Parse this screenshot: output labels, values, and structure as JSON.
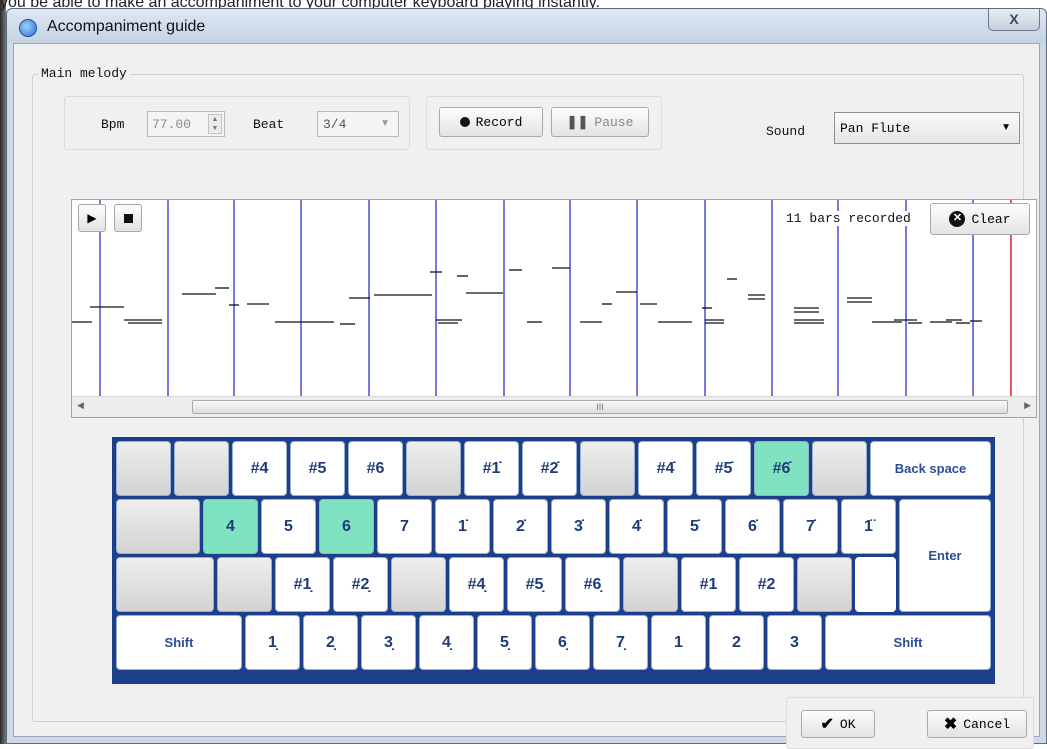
{
  "background_text": "you be able to make an accompaniment to your computer keyboard playing instantly.",
  "window": {
    "title": "Accompaniment guide",
    "close_label": "X"
  },
  "main_melody": {
    "group_label": "Main melody",
    "bpm_label": "Bpm",
    "bpm_value": "77.00",
    "beat_label": "Beat",
    "beat_value": "3/4",
    "record_label": "Record",
    "pause_label": "Pause",
    "sound_label": "Sound",
    "sound_value": "Pan Flute"
  },
  "staff": {
    "bars_recorded": "11 bars recorded",
    "clear_label": "Clear",
    "scroll_mark": "III"
  },
  "keyboard": {
    "row1": [
      "",
      "",
      "#4",
      "#5",
      "#6",
      "",
      "#1̇",
      "#2̇",
      "",
      "#4̇",
      "#5̇",
      "#6̇",
      "",
      "Back space"
    ],
    "row2": [
      "",
      "4",
      "5",
      "6",
      "7",
      "1̇",
      "2̇",
      "3̇",
      "4̇",
      "5̇",
      "6̇",
      "7̇",
      "1̈",
      "Enter"
    ],
    "row3": [
      "",
      "",
      "#1̣",
      "#2̣",
      "",
      "#4̣",
      "#5̣",
      "#6̣",
      "",
      "#1",
      "#2",
      "",
      ""
    ],
    "row4": [
      "Shift",
      "1̣",
      "2̣",
      "3̣",
      "4̣",
      "5̣",
      "6̣",
      "7̣",
      "1",
      "2",
      "3",
      "Shift"
    ],
    "highlight_color": "#7fe3c2"
  },
  "footer": {
    "ok_label": "OK",
    "cancel_label": "Cancel"
  }
}
